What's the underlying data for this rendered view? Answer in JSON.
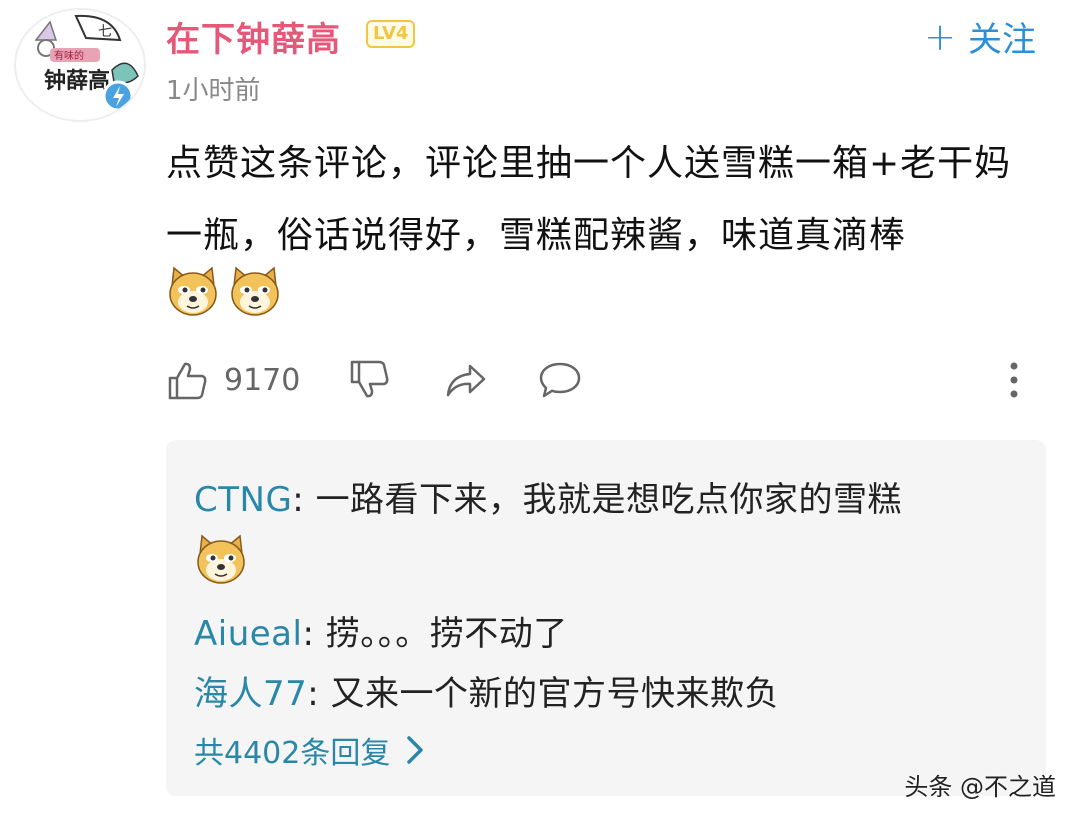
{
  "user": {
    "name": "在下钟薛高",
    "level": "LV4",
    "time": "1小时前",
    "avatar_text": "钟薛高",
    "avatar_tag": "有味的"
  },
  "follow_button": {
    "label": "关注",
    "icon": "plus-icon"
  },
  "comment": {
    "text": "点赞这条评论，评论里抽一个人送雪糕一箱+老干妈一瓶，俗话说得好，雪糕配辣酱，味道真滴棒",
    "emojis": [
      "doge",
      "doge"
    ]
  },
  "actions": {
    "like_count": "9170",
    "icons": [
      "thumbs-up-icon",
      "thumbs-down-icon",
      "share-icon",
      "comment-icon",
      "more-icon"
    ]
  },
  "replies": [
    {
      "user": "CTNG",
      "text": "一路看下来，我就是想吃点你家的雪糕",
      "emoji": "doge"
    },
    {
      "user": "Aiueal",
      "text": "捞。。。捞不动了"
    },
    {
      "user": "海人77",
      "text": "又来一个新的官方号快来欺负"
    }
  ],
  "more_replies": "共4402条回复",
  "watermark": "头条 @不之道",
  "colors": {
    "username": "#e4587a",
    "level_badge": "#f4c542",
    "follow": "#2d8fd5",
    "reply_user": "#2b87a8",
    "reply_bg": "#f5f5f5"
  }
}
